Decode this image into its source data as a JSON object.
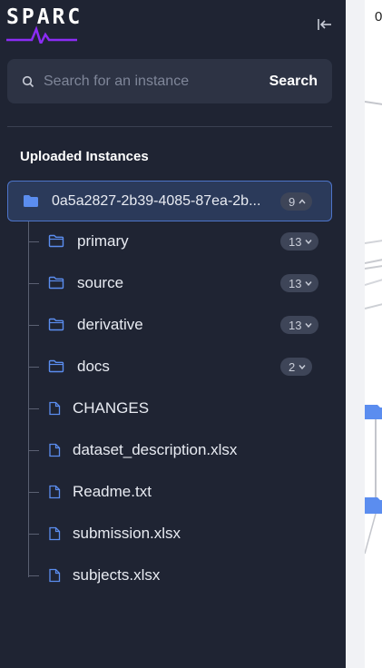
{
  "logo": {
    "text": "SPARC"
  },
  "search": {
    "placeholder": "Search for an instance",
    "button_label": "Search"
  },
  "section": {
    "title": "Uploaded Instances"
  },
  "root": {
    "label": "0a5a2827-2b39-4085-87ea-2b...",
    "count": "9"
  },
  "folders": [
    {
      "label": "primary",
      "count": "13"
    },
    {
      "label": "source",
      "count": "13"
    },
    {
      "label": "derivative",
      "count": "13"
    },
    {
      "label": "docs",
      "count": "2"
    }
  ],
  "files": [
    {
      "label": "CHANGES"
    },
    {
      "label": "dataset_description.xlsx"
    },
    {
      "label": "Readme.txt"
    },
    {
      "label": "submission.xlsx"
    },
    {
      "label": "subjects.xlsx"
    }
  ],
  "canvas": {
    "corner_text": "0"
  },
  "colors": {
    "accent": "#5b8def",
    "sidebar_bg": "#1f2433",
    "logo_wave": "#8b2cf5"
  }
}
